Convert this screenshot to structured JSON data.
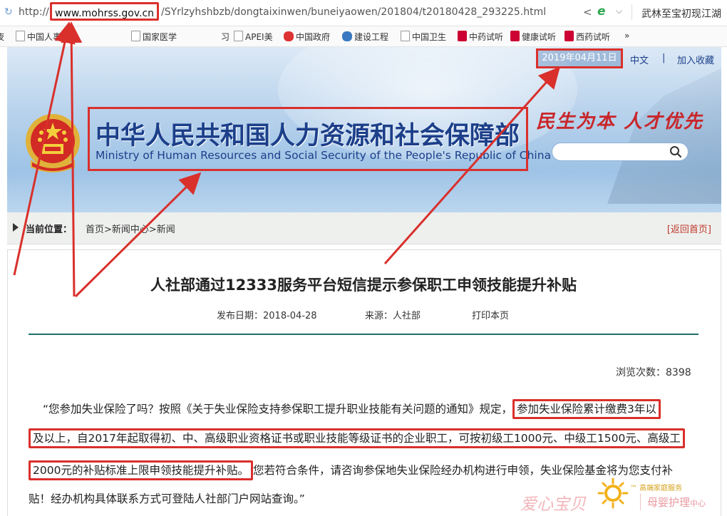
{
  "browser": {
    "url_protocol": "http://",
    "url_domain": "www.mohrss.gov.cn",
    "url_path": "/SYrlzyhshbzb/dongtaixinwen/buneiyaowen/201804/t20180428_293225.html",
    "side_text": "武林至宝初现江湖",
    "bookmarks": [
      "中国人事",
      "国家医学",
      "APEI美",
      "中国政府",
      "建设工程",
      "中国卫生",
      "中药试听",
      "健康试听",
      "西药试听"
    ]
  },
  "site": {
    "date": "2019年04月11日",
    "lang_link": "中文",
    "fav_link": "加入收藏",
    "title_cn": "中华人民共和国人力资源和社会保障部",
    "title_en": "Ministry of Human Resources and Social Security of the People's Republic of China",
    "slogan": "民生为本 人才优先",
    "search_placeholder": ""
  },
  "breadcrumb": {
    "label": "当前位置：",
    "path": "首页>新闻中心>新闻",
    "home_link": "[返回首页]"
  },
  "article": {
    "title": "人社部通过12333服务平台短信提示参保职工申领技能提升补贴",
    "publish_date": "发布日期：2018-04-28",
    "source": "来源：人社部",
    "print": "打印本页",
    "views": "浏览次数：8398",
    "p1a": "“您参加失业保险了吗？按照《关于失业保险支持参保职工提升职业技能有关问题的通知》规定，",
    "p1b": "参加失业保险累计缴费3年以",
    "p2": "及以上，自2017年起取得初、中、高级职业资格证书或职业技能等级证书的企业职工，可按初级工1000元、中级工1500元、高级工",
    "p3a": "2000元的补贴标准上限申领技能提升补贴。",
    "p3b": "您若符合条件，请咨询参保地失业保险经办机构进行申领，失业保险基金将为您支付补",
    "p4": "贴！经办机构具体联系方式可登陆人社部门户网站查询。”"
  },
  "watermark": {
    "text": "爱心宝贝",
    "tm": "™ 高端家庭服务",
    "brand": "母婴护理",
    "brand_small": "中心"
  },
  "colors": {
    "annotation_red": "#d9302c",
    "site_blue": "#1c3f8a",
    "slogan_red": "#c8262a",
    "rule_teal": "#1f6e6a"
  }
}
